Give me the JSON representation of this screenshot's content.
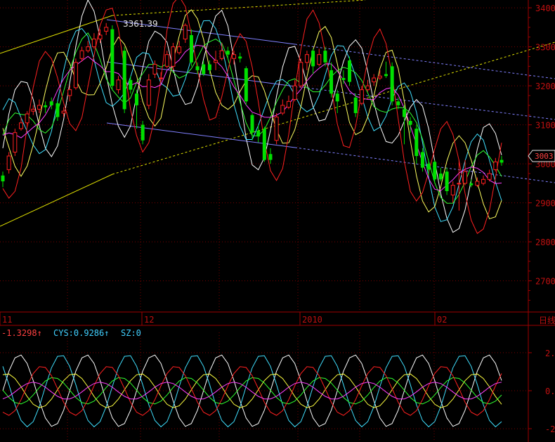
{
  "colors": {
    "background": "#000000",
    "frame": "#a00000",
    "grid": "#7a0000",
    "up": "#ff2020",
    "down": "#00e000",
    "price_tick": "#c01010",
    "label_white": "#e8e8e8"
  },
  "chart_data": [
    {
      "type": "candlestick",
      "title": "",
      "grid": true,
      "price_ticks": [
        "3400",
        "3300",
        "3200",
        "3100",
        "3000",
        "2900",
        "2800",
        "2700"
      ],
      "date_labels": [
        "11",
        "12",
        "2010",
        "02"
      ],
      "period_label": "日线",
      "last_price_label": "3003",
      "annotation": "3361.39",
      "ylim": [
        2620,
        3420
      ],
      "candle_count": 83,
      "candles": [
        {
          "o": 2970,
          "c": 2955,
          "h": 2980,
          "l": 2940
        },
        {
          "o": 2985,
          "c": 3020,
          "h": 3030,
          "l": 2975
        },
        {
          "o": 3030,
          "c": 3080,
          "h": 3090,
          "l": 3020
        },
        {
          "o": 3090,
          "c": 3105,
          "h": 3120,
          "l": 3085
        },
        {
          "o": 3105,
          "c": 3128,
          "h": 3135,
          "l": 3095
        },
        {
          "o": 3135,
          "c": 3140,
          "h": 3150,
          "l": 3125
        },
        {
          "o": 3140,
          "c": 3150,
          "h": 3165,
          "l": 3130
        },
        {
          "o": 3150,
          "c": 3145,
          "h": 3160,
          "l": 3130
        },
        {
          "o": 3160,
          "c": 3150,
          "h": 3170,
          "l": 3140
        },
        {
          "o": 3155,
          "c": 3120,
          "h": 3160,
          "l": 3110
        },
        {
          "o": 3130,
          "c": 3135,
          "h": 3145,
          "l": 3120
        },
        {
          "o": 3175,
          "c": 3190,
          "h": 3200,
          "l": 3160
        },
        {
          "o": 3195,
          "c": 3260,
          "h": 3270,
          "l": 3190
        },
        {
          "o": 3270,
          "c": 3290,
          "h": 3300,
          "l": 3262
        },
        {
          "o": 3290,
          "c": 3300,
          "h": 3315,
          "l": 3285
        },
        {
          "o": 3300,
          "c": 3320,
          "h": 3335,
          "l": 3295
        },
        {
          "o": 3320,
          "c": 3330,
          "h": 3345,
          "l": 3310
        },
        {
          "o": 3340,
          "c": 3350,
          "h": 3361,
          "l": 3330
        },
        {
          "o": 3345,
          "c": 3200,
          "h": 3355,
          "l": 3190
        },
        {
          "o": 3190,
          "c": 3215,
          "h": 3225,
          "l": 3180
        },
        {
          "o": 3290,
          "c": 3140,
          "h": 3300,
          "l": 3130
        },
        {
          "o": 3215,
          "c": 3190,
          "h": 3225,
          "l": 3180
        },
        {
          "o": 3180,
          "c": 3150,
          "h": 3190,
          "l": 3090
        },
        {
          "o": 3100,
          "c": 3060,
          "h": 3110,
          "l": 3050
        },
        {
          "o": 3150,
          "c": 3215,
          "h": 3230,
          "l": 3140
        },
        {
          "o": 3230,
          "c": 3255,
          "h": 3265,
          "l": 3220
        },
        {
          "o": 3220,
          "c": 3220,
          "h": 3235,
          "l": 3210
        },
        {
          "o": 3250,
          "c": 3280,
          "h": 3290,
          "l": 3245
        },
        {
          "o": 3250,
          "c": 3300,
          "h": 3310,
          "l": 3240
        },
        {
          "o": 3285,
          "c": 3300,
          "h": 3315,
          "l": 3280
        },
        {
          "o": 3320,
          "c": 3355,
          "h": 3360,
          "l": 3310
        },
        {
          "o": 3330,
          "c": 3260,
          "h": 3345,
          "l": 3250
        },
        {
          "o": 3250,
          "c": 3240,
          "h": 3260,
          "l": 3230
        },
        {
          "o": 3255,
          "c": 3230,
          "h": 3265,
          "l": 3225
        },
        {
          "o": 3255,
          "c": 3240,
          "h": 3265,
          "l": 3230
        },
        {
          "o": 3260,
          "c": 3265,
          "h": 3290,
          "l": 3240
        },
        {
          "o": 3270,
          "c": 3290,
          "h": 3310,
          "l": 3265
        },
        {
          "o": 3290,
          "c": 3280,
          "h": 3300,
          "l": 3270
        },
        {
          "o": 3270,
          "c": 3280,
          "h": 3290,
          "l": 3255
        },
        {
          "o": 3275,
          "c": 3270,
          "h": 3285,
          "l": 3260
        },
        {
          "o": 3245,
          "c": 3160,
          "h": 3250,
          "l": 3150
        },
        {
          "o": 3125,
          "c": 3080,
          "h": 3130,
          "l": 3060
        },
        {
          "o": 3085,
          "c": 3070,
          "h": 3100,
          "l": 3055
        },
        {
          "o": 3090,
          "c": 3010,
          "h": 3095,
          "l": 3005
        },
        {
          "o": 3025,
          "c": 3010,
          "h": 3040,
          "l": 3000
        },
        {
          "o": 3060,
          "c": 3120,
          "h": 3130,
          "l": 3050
        },
        {
          "o": 3130,
          "c": 3150,
          "h": 3165,
          "l": 3125
        },
        {
          "o": 3145,
          "c": 3160,
          "h": 3175,
          "l": 3140
        },
        {
          "o": 3165,
          "c": 3200,
          "h": 3215,
          "l": 3160
        },
        {
          "o": 3200,
          "c": 3260,
          "h": 3270,
          "l": 3195
        },
        {
          "o": 3260,
          "c": 3280,
          "h": 3290,
          "l": 3240
        },
        {
          "o": 3290,
          "c": 3250,
          "h": 3295,
          "l": 3230
        },
        {
          "o": 3255,
          "c": 3280,
          "h": 3295,
          "l": 3250
        },
        {
          "o": 3290,
          "c": 3260,
          "h": 3300,
          "l": 3250
        },
        {
          "o": 3240,
          "c": 3180,
          "h": 3260,
          "l": 3170
        },
        {
          "o": 3180,
          "c": 3160,
          "h": 3190,
          "l": 3130
        },
        {
          "o": 3220,
          "c": 3215,
          "h": 3240,
          "l": 3205
        },
        {
          "o": 3265,
          "c": 3210,
          "h": 3275,
          "l": 3200
        },
        {
          "o": 3170,
          "c": 3130,
          "h": 3180,
          "l": 3120
        },
        {
          "o": 3155,
          "c": 3190,
          "h": 3200,
          "l": 3150
        },
        {
          "o": 3190,
          "c": 3200,
          "h": 3215,
          "l": 3185
        },
        {
          "o": 3210,
          "c": 3220,
          "h": 3230,
          "l": 3200
        },
        {
          "o": 3220,
          "c": 3225,
          "h": 3240,
          "l": 3215
        },
        {
          "o": 3230,
          "c": 3225,
          "h": 3262,
          "l": 3220
        },
        {
          "o": 3250,
          "c": 3160,
          "h": 3260,
          "l": 3150
        },
        {
          "o": 3160,
          "c": 3150,
          "h": 3170,
          "l": 3140
        },
        {
          "o": 3140,
          "c": 3120,
          "h": 3150,
          "l": 3050
        },
        {
          "o": 3110,
          "c": 3100,
          "h": 3120,
          "l": 3080
        },
        {
          "o": 3090,
          "c": 3020,
          "h": 3100,
          "l": 3000
        },
        {
          "o": 3030,
          "c": 2990,
          "h": 3040,
          "l": 2980
        },
        {
          "o": 3000,
          "c": 2985,
          "h": 3010,
          "l": 2970
        },
        {
          "o": 3005,
          "c": 2960,
          "h": 3010,
          "l": 2950
        },
        {
          "o": 2975,
          "c": 2960,
          "h": 2990,
          "l": 2955
        },
        {
          "o": 2980,
          "c": 2930,
          "h": 2990,
          "l": 2920
        },
        {
          "o": 2920,
          "c": 2945,
          "h": 2955,
          "l": 2900
        },
        {
          "o": 2950,
          "c": 2950,
          "h": 3010,
          "l": 2880
        },
        {
          "o": 2950,
          "c": 2980,
          "h": 3010,
          "l": 2945
        },
        {
          "o": 2950,
          "c": 2945,
          "h": 2960,
          "l": 2940
        },
        {
          "o": 2945,
          "c": 2955,
          "h": 2965,
          "l": 2940
        },
        {
          "o": 2950,
          "c": 2960,
          "h": 2970,
          "l": 2945
        },
        {
          "o": 2960,
          "c": 2975,
          "h": 2985,
          "l": 2955
        },
        {
          "o": 2985,
          "c": 3005,
          "h": 3015,
          "l": 2980
        },
        {
          "o": 3010,
          "c": 3003,
          "h": 3020,
          "l": 2995
        }
      ]
    },
    {
      "type": "line",
      "legend": [
        {
          "text": "-1.3298↑",
          "color": "#ff4040"
        },
        {
          "text": "CYS:0.9286↑",
          "color": "#40d0ff"
        },
        {
          "text": "SZ:0",
          "color": "#40d0ff"
        }
      ],
      "y_ticks": [
        "2.",
        "0.",
        "-2."
      ],
      "ylim": [
        -2.7,
        2.7
      ],
      "series": [
        {
          "color": "#ffffff",
          "phase": 0.0,
          "amp": 1.9,
          "period": 11
        },
        {
          "color": "#40e0ff",
          "phase": 2.4,
          "amp": 1.9,
          "period": 11
        },
        {
          "color": "#ffff40",
          "phase": 1.2,
          "amp": 0.9,
          "period": 11
        },
        {
          "color": "#30ff30",
          "phase": 3.1,
          "amp": 0.7,
          "period": 11
        },
        {
          "color": "#ff2020",
          "phase": 4.2,
          "amp": 1.3,
          "period": 11
        },
        {
          "color": "#ff40ff",
          "phase": 5.0,
          "amp": 0.45,
          "period": 11
        }
      ]
    }
  ]
}
